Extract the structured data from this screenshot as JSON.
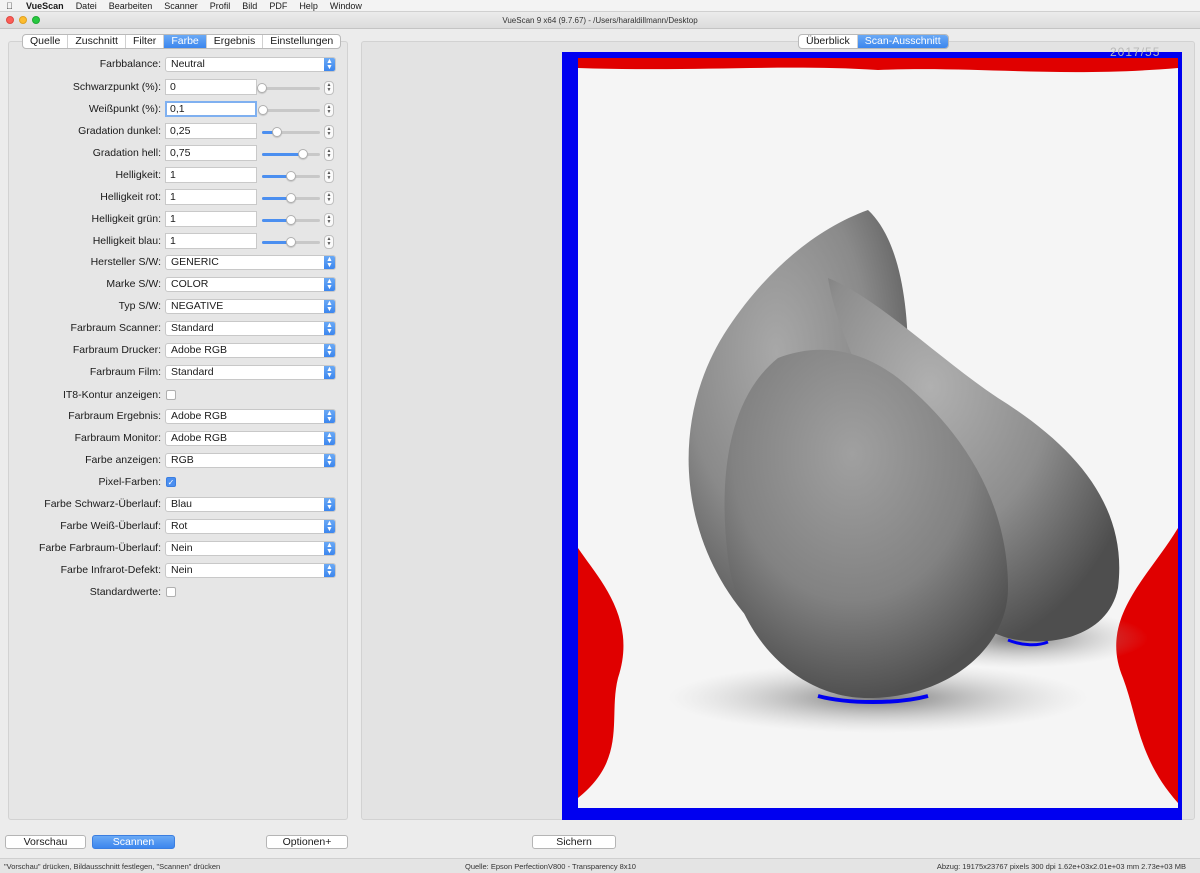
{
  "menubar": {
    "app": "VueScan",
    "items": [
      "Datei",
      "Bearbeiten",
      "Scanner",
      "Profil",
      "Bild",
      "PDF",
      "Help",
      "Window"
    ]
  },
  "window": {
    "title": "VueScan 9 x64 (9.7.67) - /Users/haraldillmann/Desktop"
  },
  "tabs": [
    "Quelle",
    "Zuschnitt",
    "Filter",
    "Farbe",
    "Ergebnis",
    "Einstellungen"
  ],
  "active_tab": "Farbe",
  "view_tabs": [
    "Überblick",
    "Scan-Ausschnitt"
  ],
  "active_view_tab": "Scan-Ausschnitt",
  "settings": {
    "farbbalance": {
      "label": "Farbbalance:",
      "value": "Neutral"
    },
    "schwarzpunkt": {
      "label": "Schwarzpunkt (%):",
      "value": "0",
      "level": 0.0
    },
    "weisspunkt": {
      "label": "Weißpunkt (%):",
      "value": "0,1",
      "level": 0.02
    },
    "gradation_dunkel": {
      "label": "Gradation dunkel:",
      "value": "0,25",
      "level": 0.25
    },
    "gradation_hell": {
      "label": "Gradation hell:",
      "value": "0,75",
      "level": 0.7
    },
    "helligkeit": {
      "label": "Helligkeit:",
      "value": "1",
      "level": 0.5
    },
    "helligkeit_rot": {
      "label": "Helligkeit rot:",
      "value": "1",
      "level": 0.5
    },
    "helligkeit_gruen": {
      "label": "Helligkeit grün:",
      "value": "1",
      "level": 0.5
    },
    "helligkeit_blau": {
      "label": "Helligkeit blau:",
      "value": "1",
      "level": 0.5
    },
    "hersteller_sw": {
      "label": "Hersteller S/W:",
      "value": "GENERIC"
    },
    "marke_sw": {
      "label": "Marke S/W:",
      "value": "COLOR"
    },
    "typ_sw": {
      "label": "Typ S/W:",
      "value": "NEGATIVE"
    },
    "farbraum_scanner": {
      "label": "Farbraum Scanner:",
      "value": "Standard"
    },
    "farbraum_drucker": {
      "label": "Farbraum Drucker:",
      "value": "Adobe RGB"
    },
    "farbraum_film": {
      "label": "Farbraum Film:",
      "value": "Standard"
    },
    "it8_kontur": {
      "label": "IT8-Kontur anzeigen:",
      "checked": false
    },
    "farbraum_ergebnis": {
      "label": "Farbraum Ergebnis:",
      "value": "Adobe RGB"
    },
    "farbraum_monitor": {
      "label": "Farbraum Monitor:",
      "value": "Adobe RGB"
    },
    "farbe_anzeigen": {
      "label": "Farbe anzeigen:",
      "value": "RGB"
    },
    "pixel_farben": {
      "label": "Pixel-Farben:",
      "checked": true
    },
    "farbe_schwarz_ueberlauf": {
      "label": "Farbe Schwarz-Überlauf:",
      "value": "Blau"
    },
    "farbe_weiss_ueberlauf": {
      "label": "Farbe Weiß-Überlauf:",
      "value": "Rot"
    },
    "farbe_farbraum_ueberlauf": {
      "label": "Farbe Farbraum-Überlauf:",
      "value": "Nein"
    },
    "farbe_infrarot_defekt": {
      "label": "Farbe Infrarot-Defekt:",
      "value": "Nein"
    },
    "standardwerte": {
      "label": "Standardwerte:",
      "checked": false
    }
  },
  "preview": {
    "corner_label": "2017/55"
  },
  "buttons": {
    "vorschau": "Vorschau",
    "scannen": "Scannen",
    "optionen": "Optionen+",
    "sichern": "Sichern"
  },
  "status": {
    "left": "\"Vorschau\" drücken, Bildausschnitt festlegen, \"Scannen\" drücken",
    "center": "Quelle: Epson PerfectionV800 - Transparency 8x10",
    "right": "Abzug: 19175x23767 pixels 300 dpi 1.62e+03x2.01e+03 mm 2.73e+03 MB"
  },
  "colors": {
    "accent": "#3c86ee",
    "black_overflow": "#0000f0",
    "white_overflow": "#e00000"
  }
}
